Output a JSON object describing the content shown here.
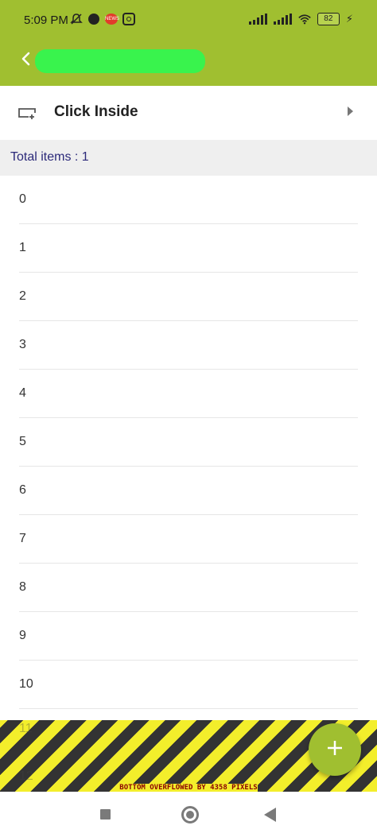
{
  "status_bar": {
    "time": "5:09 PM",
    "battery": "82",
    "icons": [
      "mute-icon",
      "app-icon",
      "news-icon",
      "instagram-icon",
      "signal-icon",
      "signal-icon",
      "wifi-icon",
      "battery-icon",
      "charging-icon"
    ]
  },
  "app_bar": {
    "background": "#a0bf30",
    "title_redacted_color": "#39f34d"
  },
  "picker": {
    "label": "Click Inside"
  },
  "summary": {
    "total_text": "Total items : 1"
  },
  "list": {
    "items": [
      "0",
      "1",
      "2",
      "3",
      "4",
      "5",
      "6",
      "7",
      "8",
      "9",
      "10"
    ],
    "overflow_items": [
      "11",
      "12"
    ]
  },
  "overflow": {
    "message": "BOTTOM OVERFLOWED BY 4358 PIXELS"
  },
  "fab": {
    "icon": "plus-icon",
    "color": "#a0bf30"
  },
  "nav": {
    "buttons": [
      "recents-button",
      "home-button",
      "back-button"
    ]
  }
}
